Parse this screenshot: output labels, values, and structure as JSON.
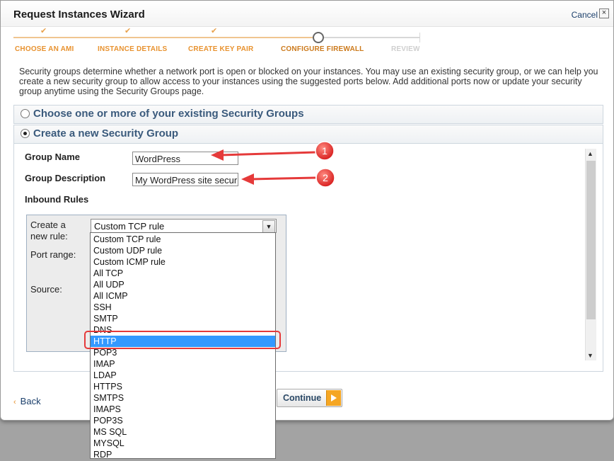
{
  "dialog": {
    "title": "Request Instances Wizard",
    "cancel_label": "Cancel",
    "close_glyph": "×"
  },
  "steps": [
    {
      "label": "CHOOSE AN AMI",
      "state": "done"
    },
    {
      "label": "INSTANCE DETAILS",
      "state": "done"
    },
    {
      "label": "CREATE KEY PAIR",
      "state": "done"
    },
    {
      "label": "CONFIGURE FIREWALL",
      "state": "current"
    },
    {
      "label": "REVIEW",
      "state": "future"
    }
  ],
  "intro": "Security groups determine whether a network port is open or blocked on your instances. You may use an existing security group, or we can help you create a new security group to allow access to your instances using the suggested ports below. Add additional ports now or update your security group anytime using the Security Groups page.",
  "options": {
    "existing": {
      "label": "Choose one or more of your existing Security Groups",
      "selected": false
    },
    "create": {
      "label": "Create a new Security Group",
      "selected": true
    }
  },
  "form": {
    "group_name_label": "Group Name",
    "group_name_value": "WordPress",
    "group_desc_label": "Group Description",
    "group_desc_value": "My WordPress site secur",
    "inbound_label": "Inbound Rules"
  },
  "rules": {
    "create_rule_label_1": "Create a",
    "create_rule_label_2": "new rule:",
    "port_range_label": "Port range:",
    "source_label": "Source:",
    "selected_rule": "Custom TCP rule",
    "options": [
      "Custom TCP rule",
      "Custom UDP rule",
      "Custom ICMP rule",
      "All TCP",
      "All UDP",
      "All ICMP",
      "SSH",
      "SMTP",
      "DNS",
      "HTTP",
      "POP3",
      "IMAP",
      "LDAP",
      "HTTPS",
      "SMTPS",
      "IMAPS",
      "POP3S",
      "MS SQL",
      "MYSQL",
      "RDP"
    ],
    "highlighted_option": "HTTP"
  },
  "annotations": {
    "marker_1": "1",
    "marker_2": "2"
  },
  "nav": {
    "back_label": "Back",
    "back_glyph": "‹",
    "continue_label": "Continue"
  },
  "colors": {
    "accent_orange": "#e8922f",
    "link_blue": "#1b3f6b",
    "highlight_red": "#e53a3a",
    "selection_blue": "#3399ff"
  }
}
